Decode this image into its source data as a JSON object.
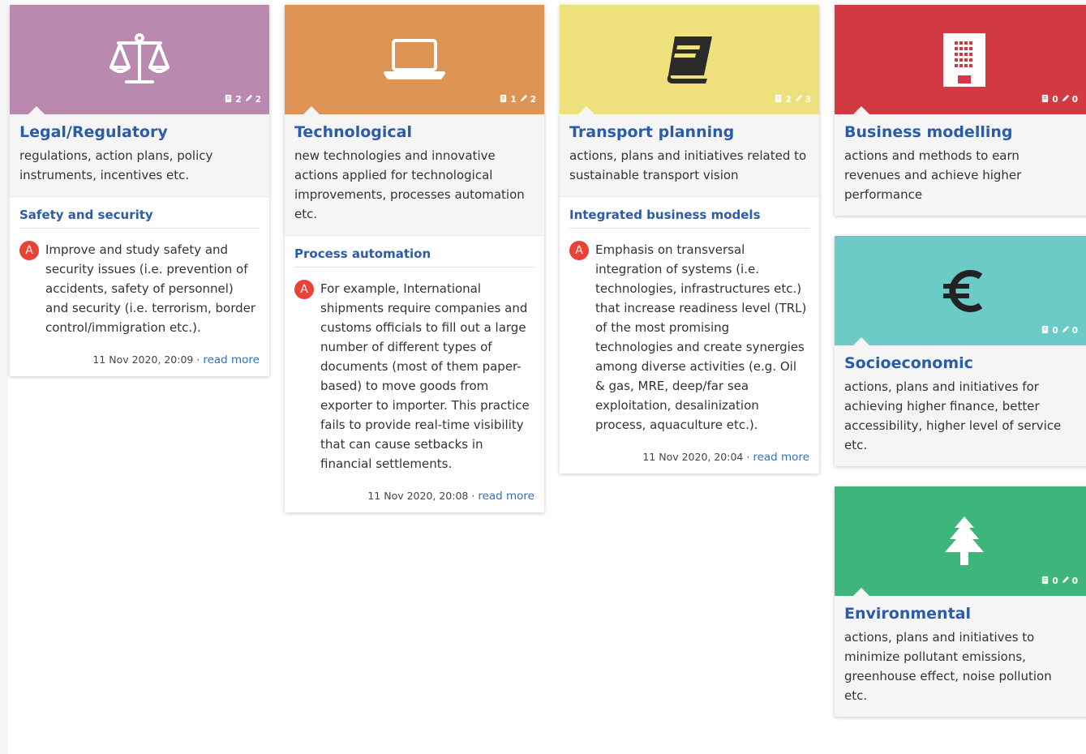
{
  "cards": [
    {
      "title": "Legal/Regulatory",
      "description": "regulations, action plans, policy instruments, incentives etc.",
      "icon": "scales-icon",
      "color": "#b989b0",
      "stats": {
        "documents": "2",
        "edits": "2"
      },
      "section": {
        "title": "Safety and security",
        "avatar": "A",
        "text": "Improve and study safety and security issues (i.e. prevention of accidents, safety of personnel) and security (i.e. terrorism, border control/immigration etc.).",
        "date": "11 Nov 2020, 20:09",
        "separator": "·",
        "link": "read more"
      }
    },
    {
      "title": "Technological",
      "description": "new technologies and innovative actions applied for technological improvements, processes automation etc.",
      "icon": "laptop-icon",
      "color": "#de9454",
      "stats": {
        "documents": "1",
        "edits": "2"
      },
      "section": {
        "title": "Process automation",
        "avatar": "A",
        "text": "For example, International shipments require companies and customs officials to fill out a large number of different types of documents (most of them paper-based) to move goods from exporter to importer. This practice fails to provide real-time visibility that can cause setbacks in financial settlements.",
        "date": "11 Nov 2020, 20:08",
        "separator": "·",
        "link": "read more"
      }
    },
    {
      "title": "Transport planning",
      "description": "actions, plans and initiatives related to sustainable transport vision",
      "icon": "book-icon",
      "color": "#eee17b",
      "stats": {
        "documents": "2",
        "edits": "3"
      },
      "section": {
        "title": "Integrated business models",
        "avatar": "A",
        "text": "Emphasis on transversal integration of systems (i.e. technologies, infrastructures etc.) that increase readiness level (TRL) of the most promising technologies and create synergies among diverse activities (e.g. Oil & gas, MRE, deep/far sea exploitation, desalinization process, aquaculture etc.).",
        "date": "11 Nov 2020, 20:04",
        "separator": "·",
        "link": "read more"
      }
    },
    {
      "title": "Business modelling",
      "description": "actions and methods to earn revenues and achieve higher performance",
      "icon": "building-icon",
      "color": "#d23a43",
      "stats": {
        "documents": "0",
        "edits": "0"
      }
    },
    {
      "title": "Socioeconomic",
      "description": "actions, plans and initiatives for achieving higher finance, better accessibility, higher level of service etc.",
      "icon": "euro-icon",
      "color": "#6ccbc7",
      "stats": {
        "documents": "0",
        "edits": "0"
      }
    },
    {
      "title": "Environmental",
      "description": "actions, plans and initiatives to minimize pollutant emissions, greenhouse effect, noise pollution etc.",
      "icon": "tree-icon",
      "color": "#3eb57b",
      "stats": {
        "documents": "0",
        "edits": "0"
      }
    }
  ]
}
